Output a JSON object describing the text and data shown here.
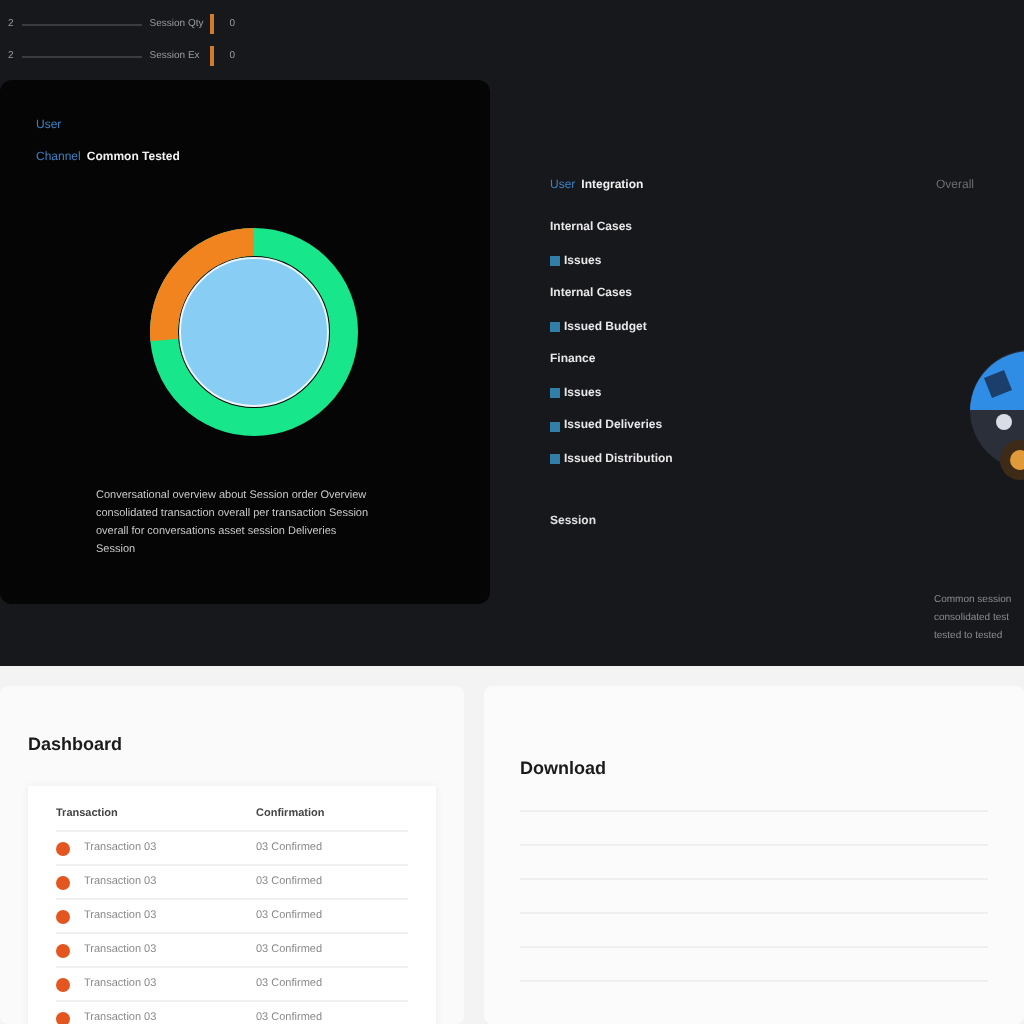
{
  "top_strip": {
    "rows": [
      {
        "index": "2",
        "label": "Session Qty",
        "value": "0"
      },
      {
        "index": "2",
        "label": "Session Ex",
        "value": "0"
      }
    ]
  },
  "chart_card": {
    "label": "User",
    "channel": "Channel",
    "channel_value": "Common Tested",
    "description": "Conversational overview about Session order Overview consolidated transaction overall per transaction Session overall for conversations asset session Deliveries Session"
  },
  "integration": {
    "title_prefix": "User",
    "title": "Integration",
    "overall": "Overall",
    "items": [
      {
        "label": "Internal Cases",
        "kind": "text"
      },
      {
        "label": "Issues",
        "kind": "tagged"
      },
      {
        "label": "Internal Cases",
        "kind": "text"
      },
      {
        "label": "Issued Budget",
        "kind": "tagged"
      },
      {
        "label": "Finance",
        "kind": "text"
      },
      {
        "label": "Issues",
        "kind": "tagged"
      },
      {
        "label": "Issued Deliveries",
        "kind": "tagged"
      },
      {
        "label": "Issued Distribution",
        "kind": "tagged"
      }
    ],
    "footer": "Session",
    "side_lines": [
      "Common session",
      "consolidated test",
      "tested to tested"
    ]
  },
  "dashboard": {
    "title": "Dashboard",
    "columns": [
      "Transaction",
      "Confirmation"
    ],
    "rows": [
      {
        "transaction": "Transaction 03",
        "confirmation": "03 Confirmed"
      },
      {
        "transaction": "Transaction 03",
        "confirmation": "03 Confirmed"
      },
      {
        "transaction": "Transaction 03",
        "confirmation": "03 Confirmed"
      },
      {
        "transaction": "Transaction 03",
        "confirmation": "03 Confirmed"
      },
      {
        "transaction": "Transaction 03",
        "confirmation": "03 Confirmed"
      },
      {
        "transaction": "Transaction 03",
        "confirmation": "03 Confirmed"
      }
    ]
  },
  "download": {
    "title": "Download"
  }
}
